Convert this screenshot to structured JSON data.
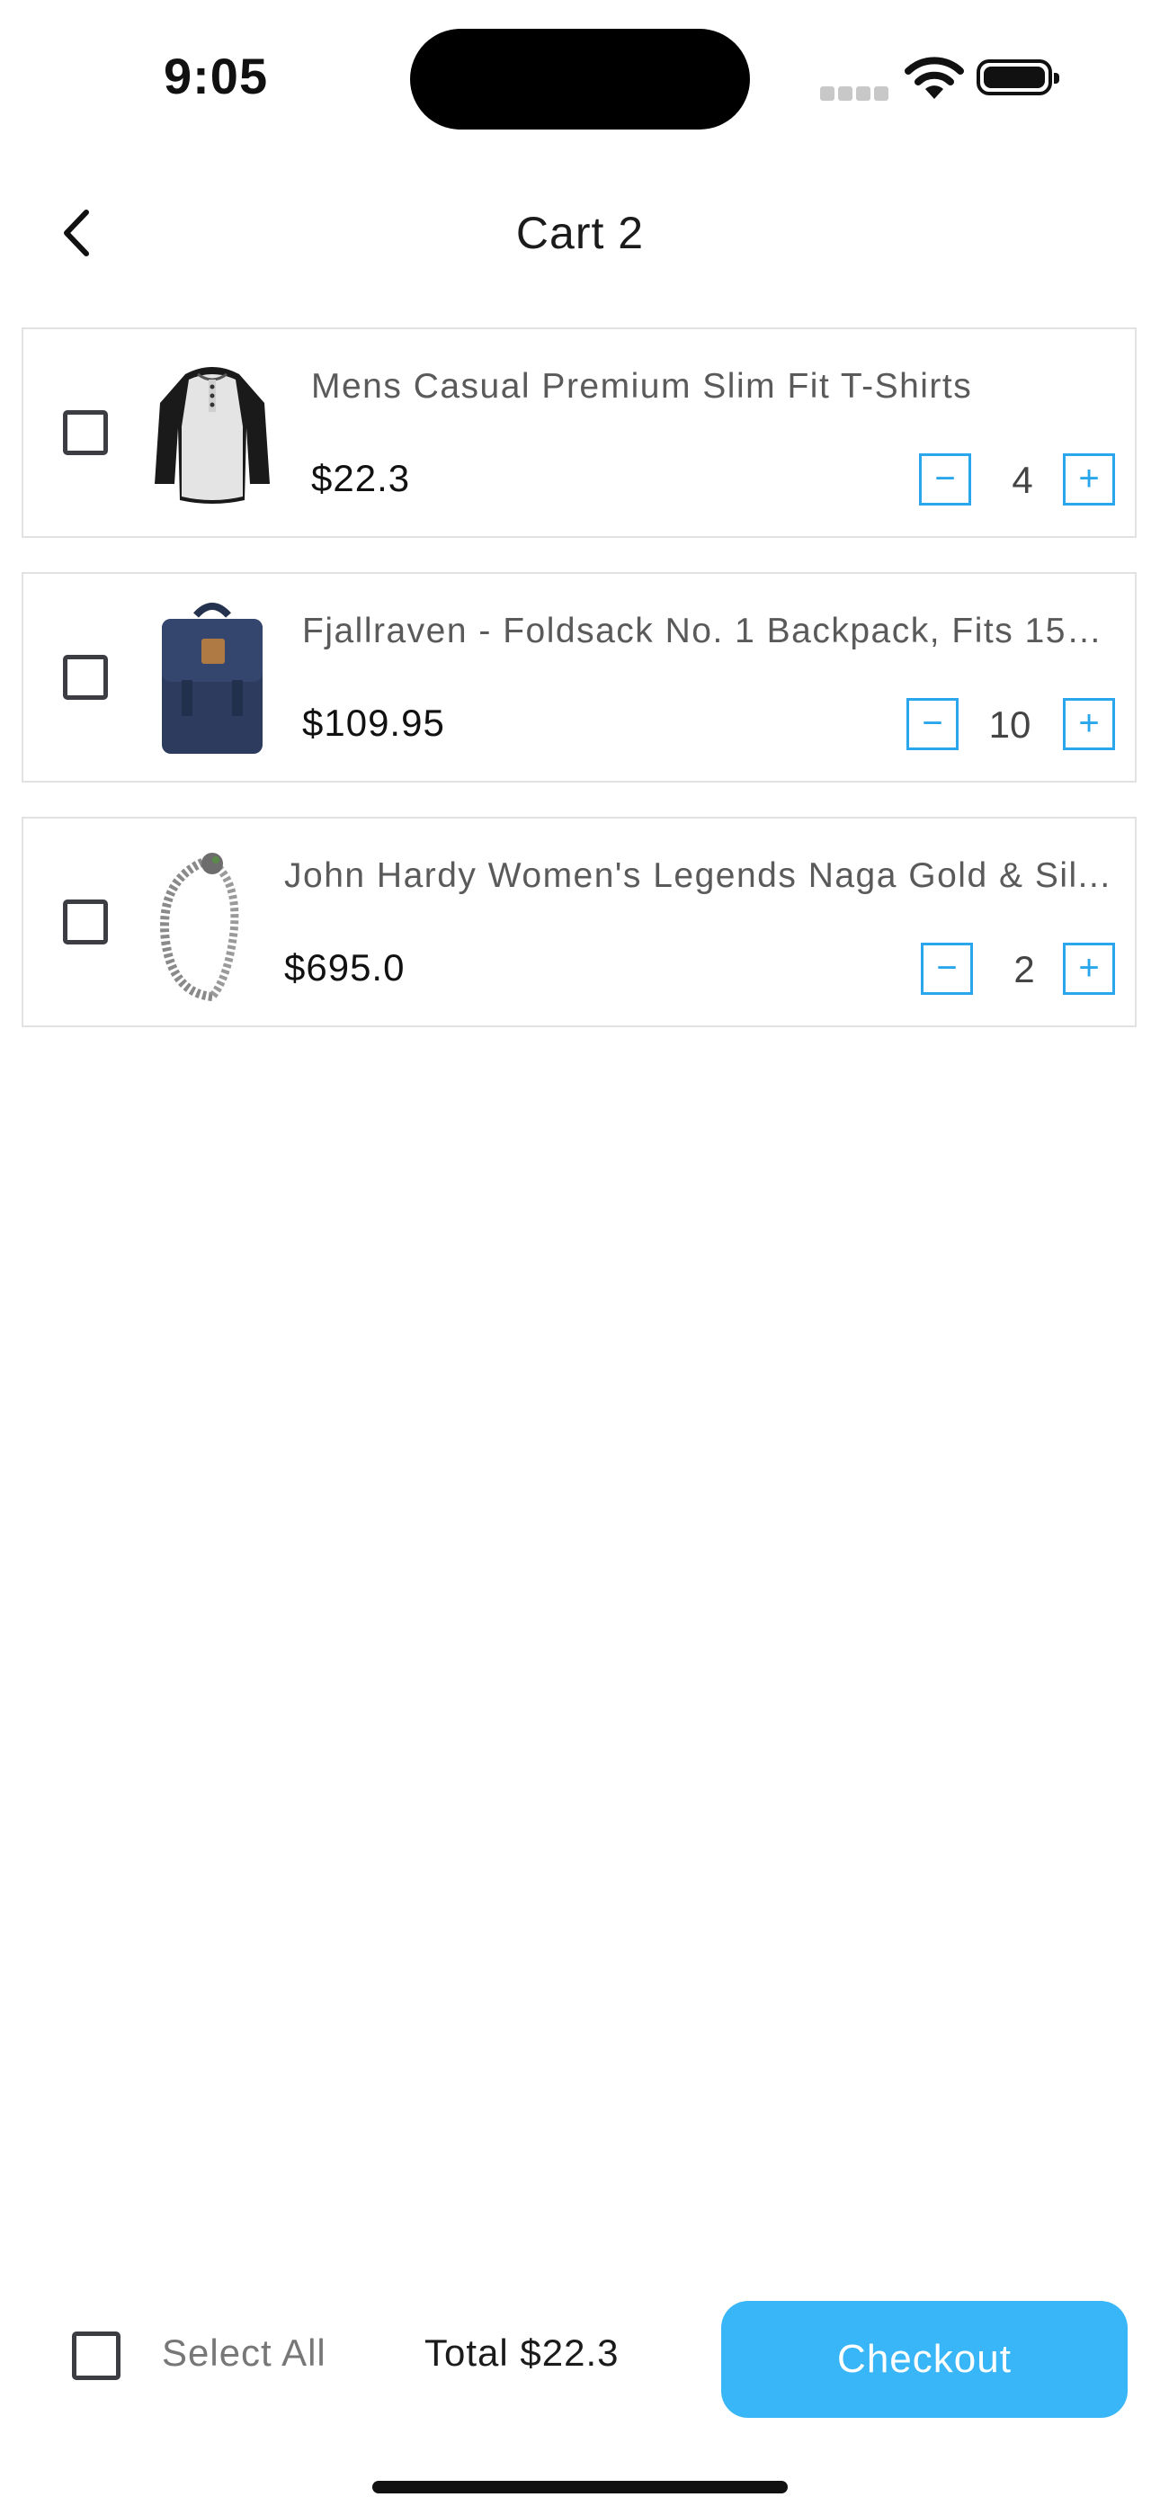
{
  "status_bar": {
    "time": "9:05"
  },
  "header": {
    "title": "Cart 2"
  },
  "items": [
    {
      "name": "Mens Casual Premium Slim Fit T-Shirts",
      "price": "$22.3",
      "quantity": "4",
      "selected": false
    },
    {
      "name": "Fjallraven - Foldsack No. 1 Backpack, Fits 15 L...",
      "price": "$109.95",
      "quantity": "10",
      "selected": false
    },
    {
      "name": "John Hardy Women's Legends Naga Gold & Sil...",
      "price": "$695.0",
      "quantity": "2",
      "selected": false
    }
  ],
  "controls": {
    "minus": "−",
    "plus": "+"
  },
  "footer": {
    "select_all_label": "Select All",
    "total_label": "Total $22.3",
    "checkout_label": "Checkout"
  },
  "colors": {
    "accent": "#38b6f8",
    "stepper": "#2aa7ec"
  }
}
